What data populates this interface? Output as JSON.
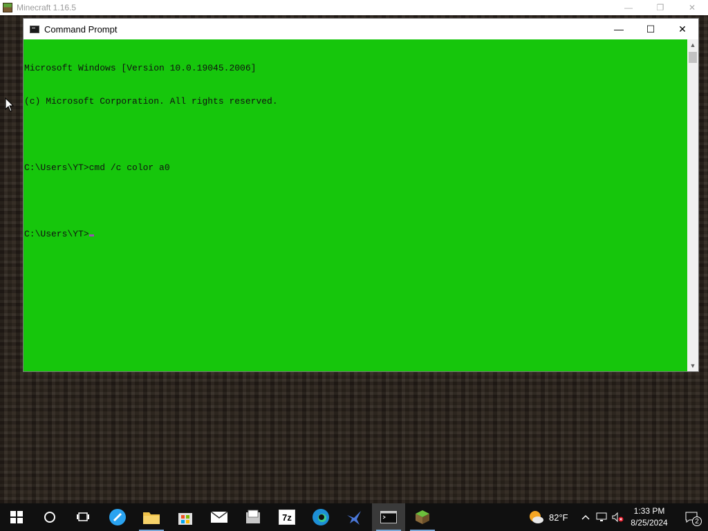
{
  "minecraft": {
    "title": "Minecraft 1.16.5",
    "controls": {
      "minimize": "—",
      "restore": "❐",
      "close": "✕"
    }
  },
  "cmd": {
    "title": "Command Prompt",
    "controls": {
      "minimize": "—",
      "maximize": "☐",
      "close": "✕"
    },
    "background_color": "#16c60c",
    "lines": [
      "Microsoft Windows [Version 10.0.19045.2006]",
      "(c) Microsoft Corporation. All rights reserved.",
      "",
      "C:\\Users\\YT>cmd /c color a0",
      "",
      "C:\\Users\\YT>"
    ]
  },
  "taskbar": {
    "items": [
      {
        "name": "start",
        "icon": "windows-logo-icon"
      },
      {
        "name": "search",
        "icon": "cortana-circle-icon"
      },
      {
        "name": "task-view",
        "icon": "task-view-icon"
      },
      {
        "name": "app",
        "icon": "blue-circle-app-icon"
      },
      {
        "name": "file-explorer",
        "icon": "folder-icon"
      },
      {
        "name": "store",
        "icon": "microsoft-store-icon"
      },
      {
        "name": "mail",
        "icon": "mail-icon"
      },
      {
        "name": "app2",
        "icon": "document-app-icon"
      },
      {
        "name": "7zip",
        "icon": "7zip-icon",
        "label": "7z"
      },
      {
        "name": "edge",
        "icon": "edge-icon"
      },
      {
        "name": "app3",
        "icon": "bird-app-icon"
      },
      {
        "name": "command-prompt",
        "icon": "cmd-icon",
        "active": true
      },
      {
        "name": "minecraft",
        "icon": "minecraft-grass-block-icon"
      }
    ],
    "weather": {
      "temp": "82°F",
      "icon": "sun-cloud-icon"
    },
    "clock": {
      "time": "1:33 PM",
      "date": "8/25/2024"
    },
    "notifications": {
      "count": "2"
    }
  }
}
